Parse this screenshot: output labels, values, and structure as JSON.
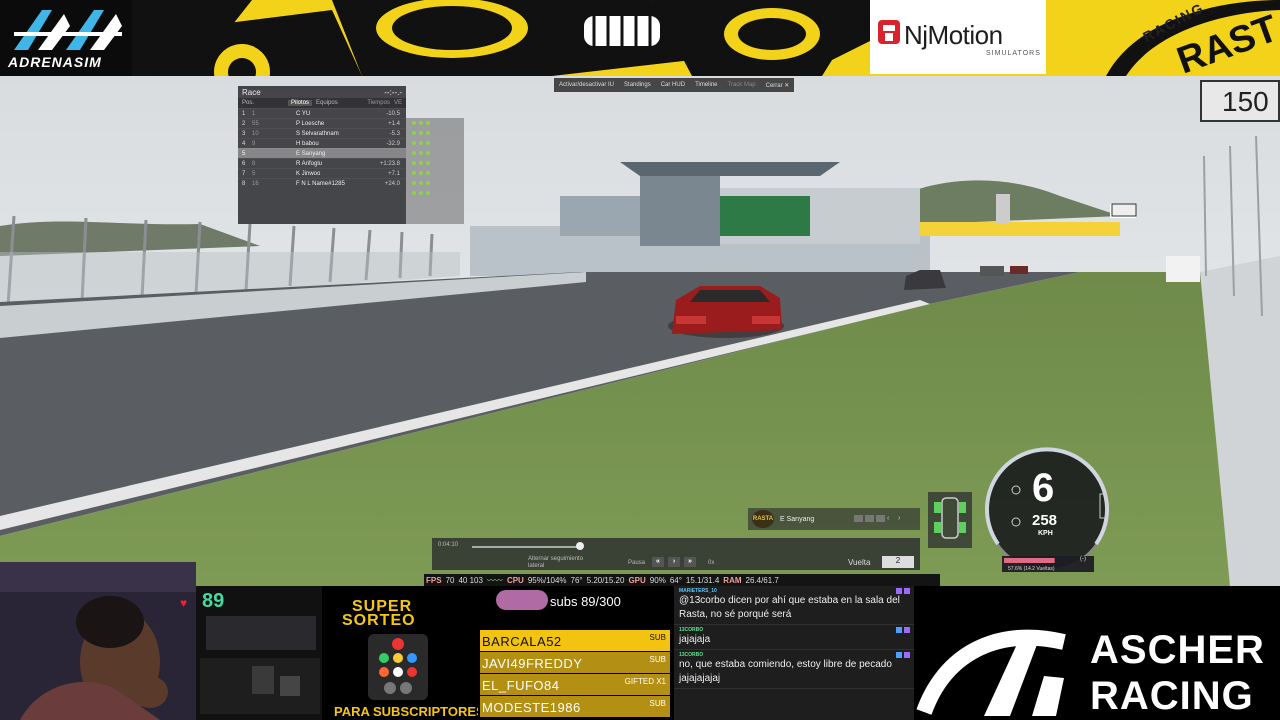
{
  "colors": {
    "banner_yellow": "#f3d21a",
    "sub_gold": "#f2c40f",
    "promo_yellow": "#f7c515",
    "hr_green": "#46d9a3"
  },
  "banner": {
    "adrenasim": "ADRENASIM",
    "njmotion": "NjMotion",
    "njmotion_sub": "SIMULATORS",
    "rasta_small": "RACING",
    "rasta_big": "RAST"
  },
  "game_menu": {
    "items": [
      "Activar/desactivar IU",
      "Standings",
      "Car HUD",
      "Timeline",
      "Track Map",
      "Cerrar ✕"
    ]
  },
  "speed_sign": "150",
  "standings": {
    "title": "Race",
    "laps": "--:--.-",
    "col_pos": "Pos.",
    "tab_pilots": "Pilotos",
    "tab_teams": "Equipos",
    "col_times": "Tiempos",
    "col_ve": "VE",
    "rows": [
      {
        "p": "1",
        "g": "1",
        "n": "C YU",
        "gap": "-10.5"
      },
      {
        "p": "2",
        "g": "55",
        "n": "P Loesche",
        "gap": "+1.4"
      },
      {
        "p": "3",
        "g": "10",
        "n": "S Selvarathnam",
        "gap": "-5.3"
      },
      {
        "p": "4",
        "g": "9",
        "n": "H babou",
        "gap": "-32.9"
      },
      {
        "p": "5",
        "g": "",
        "n": "E Sanyang",
        "gap": ""
      },
      {
        "p": "6",
        "g": "8",
        "n": "R Arifoglu",
        "gap": "+1:23.8"
      },
      {
        "p": "7",
        "g": "5",
        "n": "K Jinwoo",
        "gap": "+7.1"
      },
      {
        "p": "8",
        "g": "16",
        "n": "F N L Name#1285",
        "gap": "+24.0"
      }
    ]
  },
  "replay": {
    "time": "0:04:10",
    "alt": "Alternar seguimiento lateral",
    "pause": "Pausa",
    "speed": "0x",
    "lap_label": "Vuelta",
    "lap": "2"
  },
  "focus": {
    "logo": "RASTA",
    "driver": "E Sanyang"
  },
  "dash": {
    "gear": "6",
    "speed": "258",
    "unit": "KPH",
    "gap": "(-)",
    "fuel": "57.6% (14.2 Vueltas)",
    "fuel_fraction": 0.576
  },
  "perf": {
    "fps_label": "FPS",
    "fps": "70",
    "fps_range": "40 103",
    "cpu_label": "CPU",
    "cpu": "95%/104%",
    "cpu_temp": "76°",
    "clock": "5.20/15.20",
    "gpu_label": "GPU",
    "gpu": "90%",
    "gpu_temp": "64°",
    "vram": "15.1/31.4",
    "ram_label": "RAM",
    "ram": "26.4/61.7"
  },
  "stream": {
    "heart_rate": "89",
    "promo": {
      "line1": "SUPER",
      "line2": "SORTEO",
      "line3": "PARA SUBSCRIPTORES"
    },
    "subs": {
      "counter": "subs 89/300",
      "list": [
        {
          "name": "BARCALA52",
          "tag": "SUB"
        },
        {
          "name": "JAVI49FREDDY",
          "tag": "SUB"
        },
        {
          "name": "EL_FUFO84",
          "tag": "GIFTED X1"
        },
        {
          "name": "MODESTE1986",
          "tag": "SUB"
        }
      ]
    },
    "chat": [
      {
        "user": "MARIETERS_10",
        "text": "@13corbo dicen por ahí que estaba en la sala del Rasta, no sé porqué será"
      },
      {
        "user": "13CORBO",
        "text": "jajajaja"
      },
      {
        "user": "13CORBO",
        "text": "no, que estaba comiendo, estoy libre de pecado jajajajajaj"
      }
    ],
    "ascher": {
      "line1": "ASCHER",
      "line2": "RACING"
    }
  }
}
